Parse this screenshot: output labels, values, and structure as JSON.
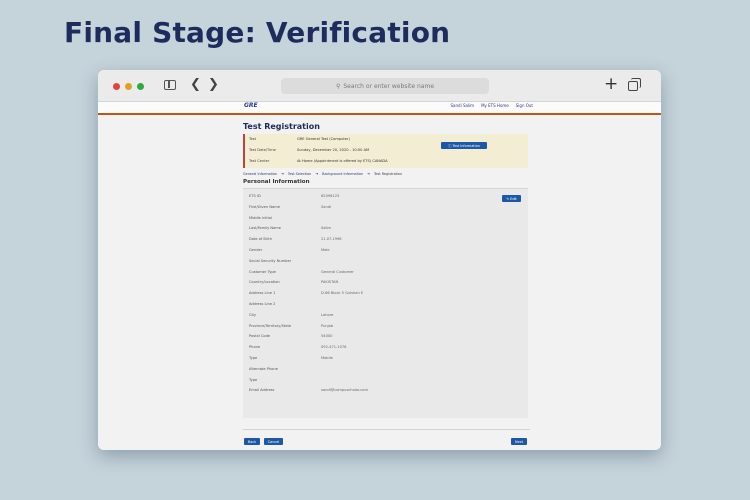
{
  "headline": "Final Stage: Verification",
  "browser": {
    "url_placeholder": "Search or enter website name",
    "icons": [
      "sidebar-icon",
      "chevron-left-icon",
      "chevron-right-icon",
      "search-icon",
      "plus-icon",
      "tabs-icon"
    ]
  },
  "site": {
    "logo": "GRE",
    "nav": [
      "Sandi Salim",
      "My ETS Home",
      "Sign Out"
    ]
  },
  "registration": {
    "title": "Test Registration",
    "info": [
      {
        "label": "Test",
        "value": "GRE General Test (Computer)"
      },
      {
        "label": "Test Date/Time",
        "value": "Sunday, December 20, 2020 - 10:00 AM"
      },
      {
        "label": "Test Center",
        "value": "At Home (Appointment is offered by ETS) CANADA"
      }
    ],
    "test_info_button": "Test Information",
    "breadcrumbs": [
      "General Information",
      "Test Selection",
      "Background Information",
      "Test Registration"
    ],
    "section_title": "Personal Information",
    "edit_button": "Edit",
    "fields": [
      {
        "label": "ETS ID",
        "value": "62096123"
      },
      {
        "label": "First/Given Name",
        "value": "Sandi"
      },
      {
        "label": "Middle Initial",
        "value": ""
      },
      {
        "label": "Last/Family Name",
        "value": "Salim"
      },
      {
        "label": "Date of Birth",
        "value": "21.07.1998"
      },
      {
        "label": "Gender",
        "value": "Male"
      },
      {
        "label": "Social Security Number",
        "value": ""
      },
      {
        "label": "Customer Type",
        "value": "General Customer"
      },
      {
        "label": "Country/Location",
        "value": "PAKISTAN"
      },
      {
        "label": "Address Line 1",
        "value": "D-66 Block 5 Gulshan E"
      },
      {
        "label": "Address Line 2",
        "value": ""
      },
      {
        "label": "City",
        "value": "Lahore"
      },
      {
        "label": "Province/Territory/State",
        "value": "Punjab"
      },
      {
        "label": "Postal Code",
        "value": "54000"
      },
      {
        "label": "Phone",
        "value": "092-471-1076"
      },
      {
        "label": "Type",
        "value": "Mobile"
      },
      {
        "label": "Alternate Phone",
        "value": ""
      },
      {
        "label": "Type",
        "value": ""
      },
      {
        "label": "Email Address",
        "value": "sandi@compuscholar.com"
      }
    ],
    "buttons": {
      "back": "Back",
      "cancel": "Cancel",
      "next": "Next"
    }
  },
  "colors": {
    "accent": "#1d58a6",
    "headline": "#1d2c5c",
    "header_rule": "#c3521b",
    "background": "#c5d3db"
  }
}
